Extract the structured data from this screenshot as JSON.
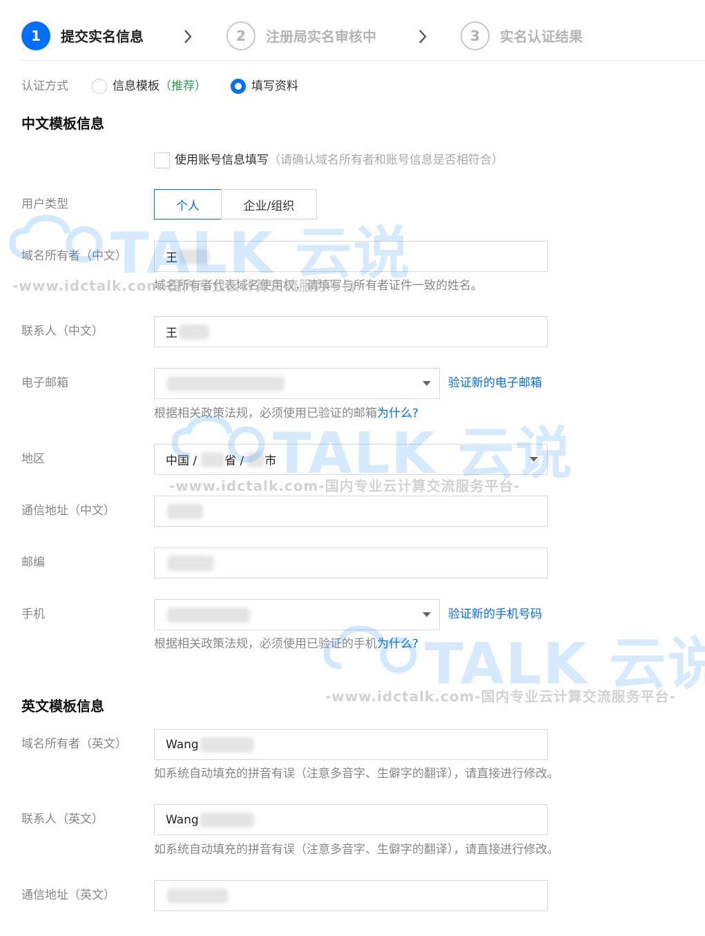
{
  "steps": [
    {
      "number": "1",
      "label": "提交实名信息"
    },
    {
      "number": "2",
      "label": "注册局实名审核中"
    },
    {
      "number": "3",
      "label": "实名认证结果"
    }
  ],
  "auth": {
    "label": "认证方式",
    "option1": "信息模板",
    "option1_tag": "（推荐）",
    "option2": "填写资料",
    "selected": "填写资料"
  },
  "cn_section": {
    "title": "中文模板信息",
    "use_account": "使用账号信息填写",
    "use_account_hint": "（请确认域名所有者和账号信息是否相符合）",
    "user_type_label": "用户类型",
    "user_type_options": [
      "个人",
      "企业/组织"
    ],
    "owner_label": "域名所有者（中文）",
    "owner_value": "王",
    "owner_help": "域名所有者代表域名使用权，请填写与所有者证件一致的姓名。",
    "contact_label": "联系人（中文）",
    "contact_value": "王",
    "email_label": "电子邮箱",
    "email_link": "验证新的电子邮箱",
    "email_help": "根据相关政策法规，必须使用已验证的邮箱",
    "why": "为什么?",
    "region_label": "地区",
    "region_country": "中国 /",
    "region_province_suffix": "省 /",
    "region_city_suffix": "市",
    "address_label": "通信地址（中文）",
    "zip_label": "邮编",
    "phone_label": "手机",
    "phone_link": "验证新的手机号码",
    "phone_help": "根据相关政策法规，必须使用已验证的手机"
  },
  "en_section": {
    "title": "英文模板信息",
    "owner_label": "域名所有者（英文）",
    "owner_value": "Wang",
    "owner_help": "如系统自动填充的拼音有误（注意多音字、生僻字的翻译），请直接进行修改。",
    "contact_label": "联系人（英文）",
    "contact_value": "Wang",
    "contact_help": "如系统自动填充的拼音有误（注意多音字、生僻字的翻译），请直接进行修改。",
    "address_label": "通信地址（英文）"
  },
  "watermark": {
    "brand": "TALK 云说",
    "url": "-www.idctalk.com-国内专业云计算交流服务平台-"
  },
  "colors": {
    "primary": "#006eff",
    "recommend": "#29a150"
  }
}
